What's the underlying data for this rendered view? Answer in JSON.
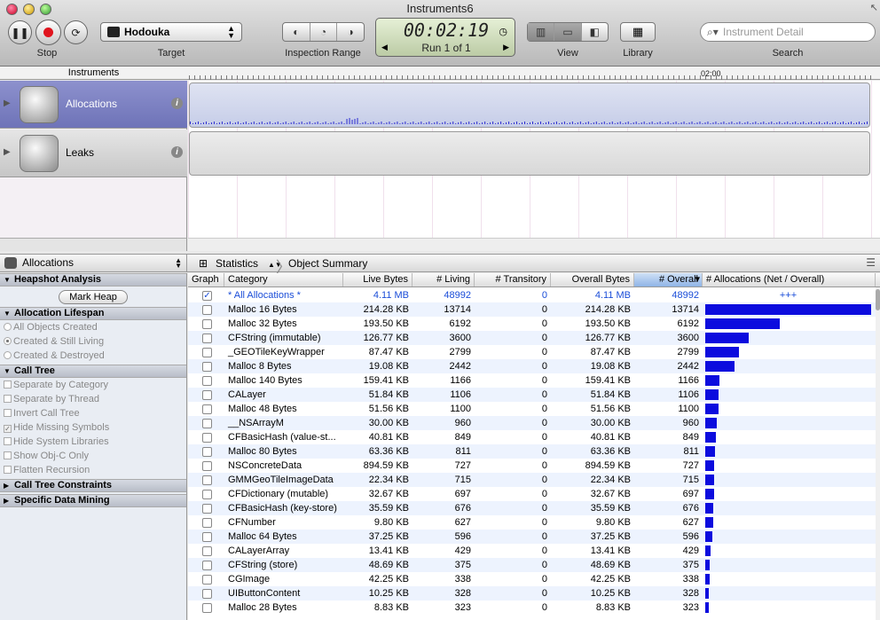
{
  "window": {
    "title": "Instruments6"
  },
  "toolbar": {
    "stop_label": "Stop",
    "target_label": "Target",
    "target_value": "Hodouka",
    "inspection_range_label": "Inspection Range",
    "time": "00:02:19",
    "run": "Run 1 of 1",
    "view_label": "View",
    "library_label": "Library",
    "search_label": "Search",
    "search_placeholder": "Instrument Detail"
  },
  "timeline": {
    "instruments_header": "Instruments",
    "ruler_label": "02:00",
    "tracks": [
      {
        "name": "Allocations",
        "selected": true
      },
      {
        "name": "Leaks",
        "selected": false
      }
    ]
  },
  "detail": {
    "instrument": "Allocations",
    "breadcrumb": [
      "Statistics",
      "Object Summary"
    ]
  },
  "sidebar": {
    "heapshot": {
      "title": "Heapshot Analysis",
      "button": "Mark Heap"
    },
    "lifespan": {
      "title": "Allocation Lifespan",
      "options": [
        "All Objects Created",
        "Created & Still Living",
        "Created & Destroyed"
      ],
      "selected": 1
    },
    "calltree": {
      "title": "Call Tree",
      "options": [
        {
          "label": "Separate by Category",
          "checked": false
        },
        {
          "label": "Separate by Thread",
          "checked": false
        },
        {
          "label": "Invert Call Tree",
          "checked": false
        },
        {
          "label": "Hide Missing Symbols",
          "checked": true
        },
        {
          "label": "Hide System Libraries",
          "checked": false
        },
        {
          "label": "Show Obj-C Only",
          "checked": false
        },
        {
          "label": "Flatten Recursion",
          "checked": false
        }
      ]
    },
    "constraints": {
      "title": "Call Tree Constraints"
    },
    "mining": {
      "title": "Specific Data Mining"
    }
  },
  "table": {
    "columns": [
      "Graph",
      "Category",
      "Live Bytes",
      "# Living",
      "# Transitory",
      "Overall Bytes",
      "# Overall",
      "# Allocations (Net / Overall)"
    ],
    "sorted_column": 6,
    "summary": {
      "category": "* All Allocations *",
      "live_bytes": "4.11 MB",
      "living": "48992",
      "transitory": "0",
      "overall_bytes": "4.11 MB",
      "overall": "48992",
      "graph_text": "+++",
      "checked": true
    },
    "rows": [
      {
        "category": "Malloc 16 Bytes",
        "live_bytes": "214.28 KB",
        "living": "13714",
        "transitory": "0",
        "overall_bytes": "214.28 KB",
        "overall": "13714"
      },
      {
        "category": "Malloc 32 Bytes",
        "live_bytes": "193.50 KB",
        "living": "6192",
        "transitory": "0",
        "overall_bytes": "193.50 KB",
        "overall": "6192"
      },
      {
        "category": "CFString (immutable)",
        "live_bytes": "126.77 KB",
        "living": "3600",
        "transitory": "0",
        "overall_bytes": "126.77 KB",
        "overall": "3600"
      },
      {
        "category": "_GEOTileKeyWrapper",
        "live_bytes": "87.47 KB",
        "living": "2799",
        "transitory": "0",
        "overall_bytes": "87.47 KB",
        "overall": "2799"
      },
      {
        "category": "Malloc 8 Bytes",
        "live_bytes": "19.08 KB",
        "living": "2442",
        "transitory": "0",
        "overall_bytes": "19.08 KB",
        "overall": "2442"
      },
      {
        "category": "Malloc 140 Bytes",
        "live_bytes": "159.41 KB",
        "living": "1166",
        "transitory": "0",
        "overall_bytes": "159.41 KB",
        "overall": "1166"
      },
      {
        "category": "CALayer",
        "live_bytes": "51.84 KB",
        "living": "1106",
        "transitory": "0",
        "overall_bytes": "51.84 KB",
        "overall": "1106"
      },
      {
        "category": "Malloc 48 Bytes",
        "live_bytes": "51.56 KB",
        "living": "1100",
        "transitory": "0",
        "overall_bytes": "51.56 KB",
        "overall": "1100"
      },
      {
        "category": "__NSArrayM",
        "live_bytes": "30.00 KB",
        "living": "960",
        "transitory": "0",
        "overall_bytes": "30.00 KB",
        "overall": "960"
      },
      {
        "category": "CFBasicHash (value-st...",
        "live_bytes": "40.81 KB",
        "living": "849",
        "transitory": "0",
        "overall_bytes": "40.81 KB",
        "overall": "849"
      },
      {
        "category": "Malloc 80 Bytes",
        "live_bytes": "63.36 KB",
        "living": "811",
        "transitory": "0",
        "overall_bytes": "63.36 KB",
        "overall": "811"
      },
      {
        "category": "NSConcreteData",
        "live_bytes": "894.59 KB",
        "living": "727",
        "transitory": "0",
        "overall_bytes": "894.59 KB",
        "overall": "727"
      },
      {
        "category": "GMMGeoTileImageData",
        "live_bytes": "22.34 KB",
        "living": "715",
        "transitory": "0",
        "overall_bytes": "22.34 KB",
        "overall": "715"
      },
      {
        "category": "CFDictionary (mutable)",
        "live_bytes": "32.67 KB",
        "living": "697",
        "transitory": "0",
        "overall_bytes": "32.67 KB",
        "overall": "697"
      },
      {
        "category": "CFBasicHash (key-store)",
        "live_bytes": "35.59 KB",
        "living": "676",
        "transitory": "0",
        "overall_bytes": "35.59 KB",
        "overall": "676"
      },
      {
        "category": "CFNumber",
        "live_bytes": "9.80 KB",
        "living": "627",
        "transitory": "0",
        "overall_bytes": "9.80 KB",
        "overall": "627"
      },
      {
        "category": "Malloc 64 Bytes",
        "live_bytes": "37.25 KB",
        "living": "596",
        "transitory": "0",
        "overall_bytes": "37.25 KB",
        "overall": "596"
      },
      {
        "category": "CALayerArray",
        "live_bytes": "13.41 KB",
        "living": "429",
        "transitory": "0",
        "overall_bytes": "13.41 KB",
        "overall": "429"
      },
      {
        "category": "CFString (store)",
        "live_bytes": "48.69 KB",
        "living": "375",
        "transitory": "0",
        "overall_bytes": "48.69 KB",
        "overall": "375"
      },
      {
        "category": "CGImage",
        "live_bytes": "42.25 KB",
        "living": "338",
        "transitory": "0",
        "overall_bytes": "42.25 KB",
        "overall": "338"
      },
      {
        "category": "UIButtonContent",
        "live_bytes": "10.25 KB",
        "living": "328",
        "transitory": "0",
        "overall_bytes": "10.25 KB",
        "overall": "328"
      },
      {
        "category": "Malloc 28 Bytes",
        "live_bytes": "8.83 KB",
        "living": "323",
        "transitory": "0",
        "overall_bytes": "8.83 KB",
        "overall": "323"
      }
    ]
  },
  "colors": {
    "bar": "#0c0cde",
    "summary_text": "#1a4dd8",
    "selected_track": "#7b80c2"
  },
  "icons": [
    "pause-icon",
    "record-icon",
    "cycle-icon",
    "terminal-icon",
    "search-icon",
    "library-icon",
    "info-icon",
    "disclosure-triangle-icon",
    "grid-icon"
  ]
}
